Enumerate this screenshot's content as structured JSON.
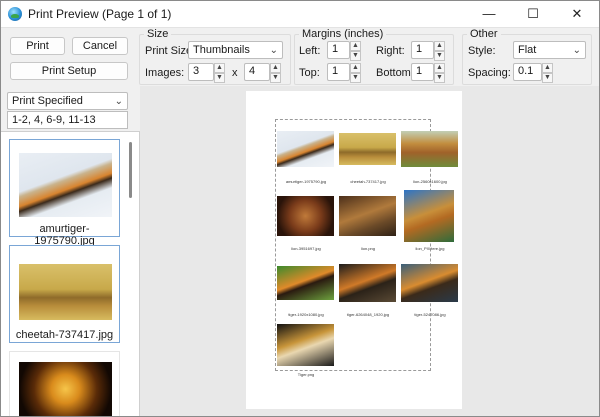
{
  "window": {
    "title": "Print Preview (Page 1 of 1)",
    "minimize_glyph": "—",
    "maximize_glyph": "☐",
    "close_glyph": "✕"
  },
  "actions": {
    "print": "Print",
    "cancel": "Cancel",
    "print_setup": "Print Setup"
  },
  "size_group": {
    "legend": "Size",
    "print_size_label": "Print Size:",
    "print_size_value": "Thumbnails",
    "images_label": "Images:",
    "images_cols": "3",
    "times": "x",
    "images_rows": "4"
  },
  "margins_group": {
    "legend": "Margins (inches)",
    "left_label": "Left:",
    "left_value": "1",
    "right_label": "Right:",
    "right_value": "1",
    "top_label": "Top:",
    "top_value": "1",
    "bottom_label": "Bottom:",
    "bottom_value": "1"
  },
  "other_group": {
    "legend": "Other",
    "style_label": "Style:",
    "style_value": "Flat",
    "spacing_label": "Spacing:",
    "spacing_value": "0.1"
  },
  "range": {
    "mode": "Print Specified",
    "pages": "1-2, 4, 6-9, 11-13"
  },
  "thumbnails": [
    {
      "caption": "amurtiger-1975790.jpg",
      "icon": "tiger-snow-image"
    },
    {
      "caption": "cheetah-737417.jpg",
      "icon": "cheetah-image"
    },
    {
      "caption": "",
      "icon": "lion-image"
    }
  ],
  "preview_captions": [
    "amurtiger-1975790.jpg",
    "cheetah-737417.jpg",
    "lion-2560x1600.jpg",
    "lion-3951697.jpg",
    "lion.png",
    "lion_PXHere.jpg",
    "tiger-1920x1080.jpg",
    "tiger-6264048_1920.jpg",
    "tiger-5247086.jpg",
    "Tiger.png"
  ],
  "colors": {
    "accent_border": "#7aa6d6",
    "window_bg": "#f0f0f0"
  }
}
